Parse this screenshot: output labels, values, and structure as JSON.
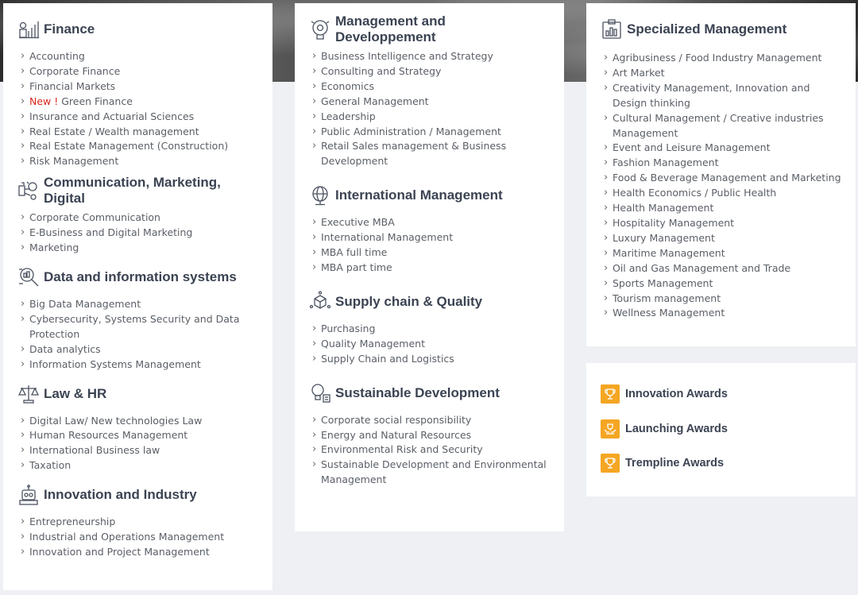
{
  "col1": {
    "finance": {
      "title": "Finance",
      "icon": "finance-icon",
      "items": [
        "Accounting",
        "Corporate Finance",
        "Financial Markets",
        "Green Finance",
        "Insurance and Actuarial Sciences",
        "Real Estate / Wealth management",
        "Real Estate Management (Construction)",
        "Risk Management"
      ],
      "new_label": "New !"
    },
    "communication": {
      "title": "Communication, Marketing, Digital",
      "icon": "megaphone-icon",
      "items": [
        "Corporate Communication",
        "E-Business and Digital Marketing",
        "Marketing"
      ]
    },
    "data": {
      "title": "Data and information systems",
      "icon": "magnifier-data-icon",
      "items": [
        "Big Data Management",
        "Cybersecurity, Systems Security and Data Protection",
        "Data analytics",
        "Information Systems Management"
      ]
    },
    "law": {
      "title": "Law & HR",
      "icon": "scales-icon",
      "items": [
        "Digital Law/ New technologies Law",
        "Human Resources Management",
        "International Business law",
        "Taxation"
      ]
    },
    "innovation": {
      "title": "Innovation and Industry",
      "icon": "robot-icon",
      "items": [
        "Entrepreneurship",
        "Industrial and Operations Management",
        "Innovation and Project Management"
      ]
    }
  },
  "col2": {
    "management": {
      "title": "Management and Developpement",
      "icon": "brain-gear-icon",
      "items": [
        "Business Intelligence and Strategy",
        "Consulting and Strategy",
        "Economics",
        "General Management",
        "Leadership",
        "Public Administration / Management",
        "Retail Sales management & Business Development"
      ]
    },
    "international": {
      "title": "International Management",
      "icon": "globe-icon",
      "items": [
        "Executive MBA",
        "International Management",
        "MBA full time",
        "MBA part time"
      ]
    },
    "supply": {
      "title": "Supply chain & Quality",
      "icon": "box-network-icon",
      "items": [
        "Purchasing",
        "Quality Management",
        "Supply Chain and Logistics"
      ]
    },
    "sustainable": {
      "title": "Sustainable Development",
      "icon": "lightbulb-icon",
      "items": [
        "Corporate social responsibility",
        "Energy and Natural Resources",
        "Environmental Risk and Security",
        "Sustainable Development and Environmental Management"
      ]
    }
  },
  "col3": {
    "specialized": {
      "title": "Specialized Management",
      "icon": "clipboard-chart-icon",
      "items": [
        "Agribusiness / Food Industry Management",
        "Art Market",
        "Creativity Management, Innovation and Design thinking",
        "Cultural Management / Creative industries Management",
        "Event and Leisure Management",
        "Fashion Management",
        "Food & Beverage Management and Marketing",
        "Health Economics / Public Health",
        "Health Management",
        "Hospitality Management",
        "Luxury Management",
        "Maritime Management",
        "Oil and Gas Management and Trade",
        "Sports Management",
        "Tourism management",
        "Wellness Management"
      ]
    }
  },
  "awards": [
    {
      "label": "Innovation Awards",
      "icon": "trophy-icon"
    },
    {
      "label": "Launching Awards",
      "icon": "hands-trophy-icon"
    },
    {
      "label": "Trempline Awards",
      "icon": "trophy-icon"
    }
  ],
  "colors": {
    "accent": "#f5a623",
    "new": "#d9261c",
    "title": "#3b4352"
  }
}
